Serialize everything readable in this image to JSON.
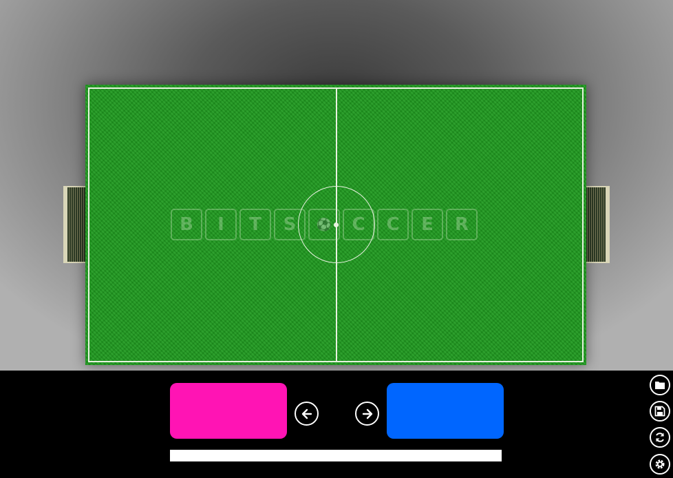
{
  "logo": {
    "letters": [
      "B",
      "I",
      "T",
      "S",
      "⚽",
      "C",
      "C",
      "E",
      "R"
    ]
  },
  "teams": {
    "left": {
      "color": "#ff14b4"
    },
    "right": {
      "color": "#0066ff"
    }
  },
  "controls": {
    "prev_icon": "arrow-left-icon",
    "next_icon": "arrow-right-icon"
  },
  "progress": {
    "fraction": 1.0
  },
  "side_toolbar": [
    {
      "icon": "folder-icon"
    },
    {
      "icon": "save-icon"
    },
    {
      "icon": "refresh-icon"
    },
    {
      "icon": "settings-icon"
    }
  ],
  "colors": {
    "field": "#1f9a1f",
    "lines": "#e8f2e0",
    "background": "#000000"
  }
}
